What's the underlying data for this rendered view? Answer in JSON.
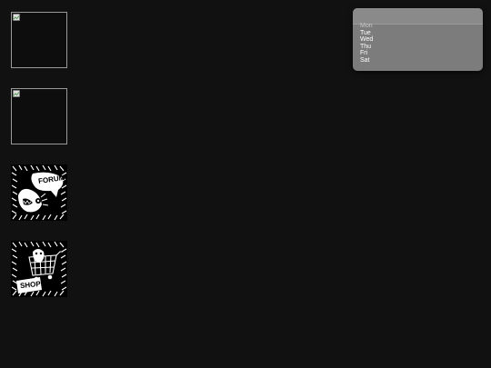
{
  "tiles": [
    {
      "kind": "broken-image"
    },
    {
      "kind": "broken-image"
    },
    {
      "kind": "badge",
      "label": "FORUM"
    },
    {
      "kind": "badge",
      "label": "SHOP"
    }
  ],
  "day_dropdown": {
    "options": [
      "Mon",
      "Tue",
      "Wed",
      "Thu",
      "Fri",
      "Sat"
    ],
    "highlighted": "Mon"
  }
}
